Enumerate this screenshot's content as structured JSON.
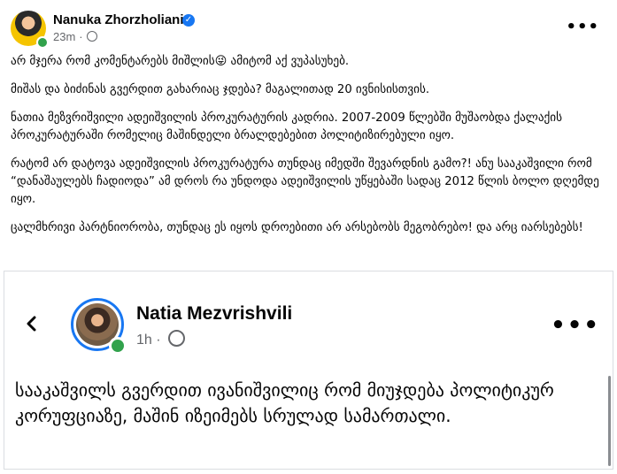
{
  "post": {
    "author": "Nanuka Zhorzholiani",
    "time": "23m",
    "separator": "·",
    "verified_mark": "✓",
    "paragraphs": [
      "არ მჯერა რომ კომენტარებს მიშლის😜 ამიტომ აქ ვუპასუხებ.",
      "მიშას და ბიძინას გვერდით გახარიაც ჯდება? მაგალითად 20 ივნისისთვის.",
      "ნათია მეზვრიშვილი ადეიშვილის პროკურატურის კადრია. 2007-2009 წლებში მუშაობდა ქალაქის პროკურატურაში რომელიც მაშინდელი ბრალდებებით პოლიტიზირებული იყო.",
      "რატომ არ დატოვა ადეიშვილის პროკურატურა თუნდაც იმედში შევარდნის გამო?! ანუ სააკაშვილი რომ “დანაშაულებს ჩადიოდა” ამ დროს რა უნდოდა ადეიშვილის უწყებაში სადაც 2012 წლის ბოლო დღემდე იყო.",
      "ცალმხრივი პარტნიორობა, თუნდაც ეს იყოს დროებითი არ არსებობს მეგობრებო! და არც იარსებებს!"
    ]
  },
  "shared": {
    "author": "Natia Mezvrishvili",
    "time": "1h",
    "separator": "·",
    "text": "სააკაშვილს გვერდით ივანიშვილიც რომ მიუჯდება პოლიტიკურ კორუფციაზე, მაშინ იზეიმებს სრულად სამართალი."
  },
  "icons": {
    "more": "more-horizontal-icon",
    "back": "chevron-left-icon",
    "audience": "globe-icon",
    "verified": "verified-badge-icon"
  },
  "colors": {
    "verified_blue": "#1877f2",
    "online_green": "#31a24c",
    "meta_gray": "#65676b"
  }
}
